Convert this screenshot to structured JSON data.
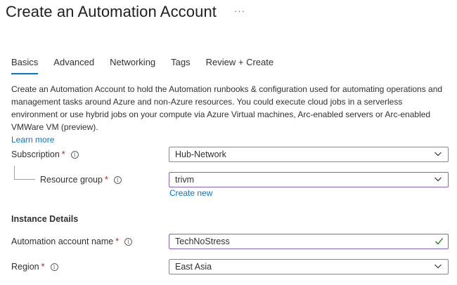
{
  "page": {
    "title": "Create an Automation Account",
    "more": "···"
  },
  "tabs": [
    {
      "label": "Basics",
      "active": true
    },
    {
      "label": "Advanced"
    },
    {
      "label": "Networking"
    },
    {
      "label": "Tags"
    },
    {
      "label": "Review + Create"
    }
  ],
  "description": {
    "text": "Create an Automation Account to hold the Automation runbooks & configuration used for automating operations and management tasks around Azure and non-Azure resources. You could execute cloud jobs in a serverless environment or use hybrid jobs on your compute via Azure Virtual machines, Arc-enabled servers or Arc-enabled VMWare VM (preview).",
    "learn_more": "Learn more"
  },
  "form": {
    "required_mark": "*",
    "subscription": {
      "label": "Subscription",
      "value": "Hub-Network"
    },
    "resource_group": {
      "label": "Resource group",
      "value": "trivm",
      "create_new": "Create new"
    },
    "instance_details": "Instance Details",
    "account_name": {
      "label": "Automation account name",
      "value": "TechNoStress",
      "valid": true
    },
    "region": {
      "label": "Region",
      "value": "East Asia"
    }
  },
  "colors": {
    "accent": "#0078d4",
    "focus": "#8764b8",
    "valid": "#107c10",
    "required": "#a4262c"
  }
}
